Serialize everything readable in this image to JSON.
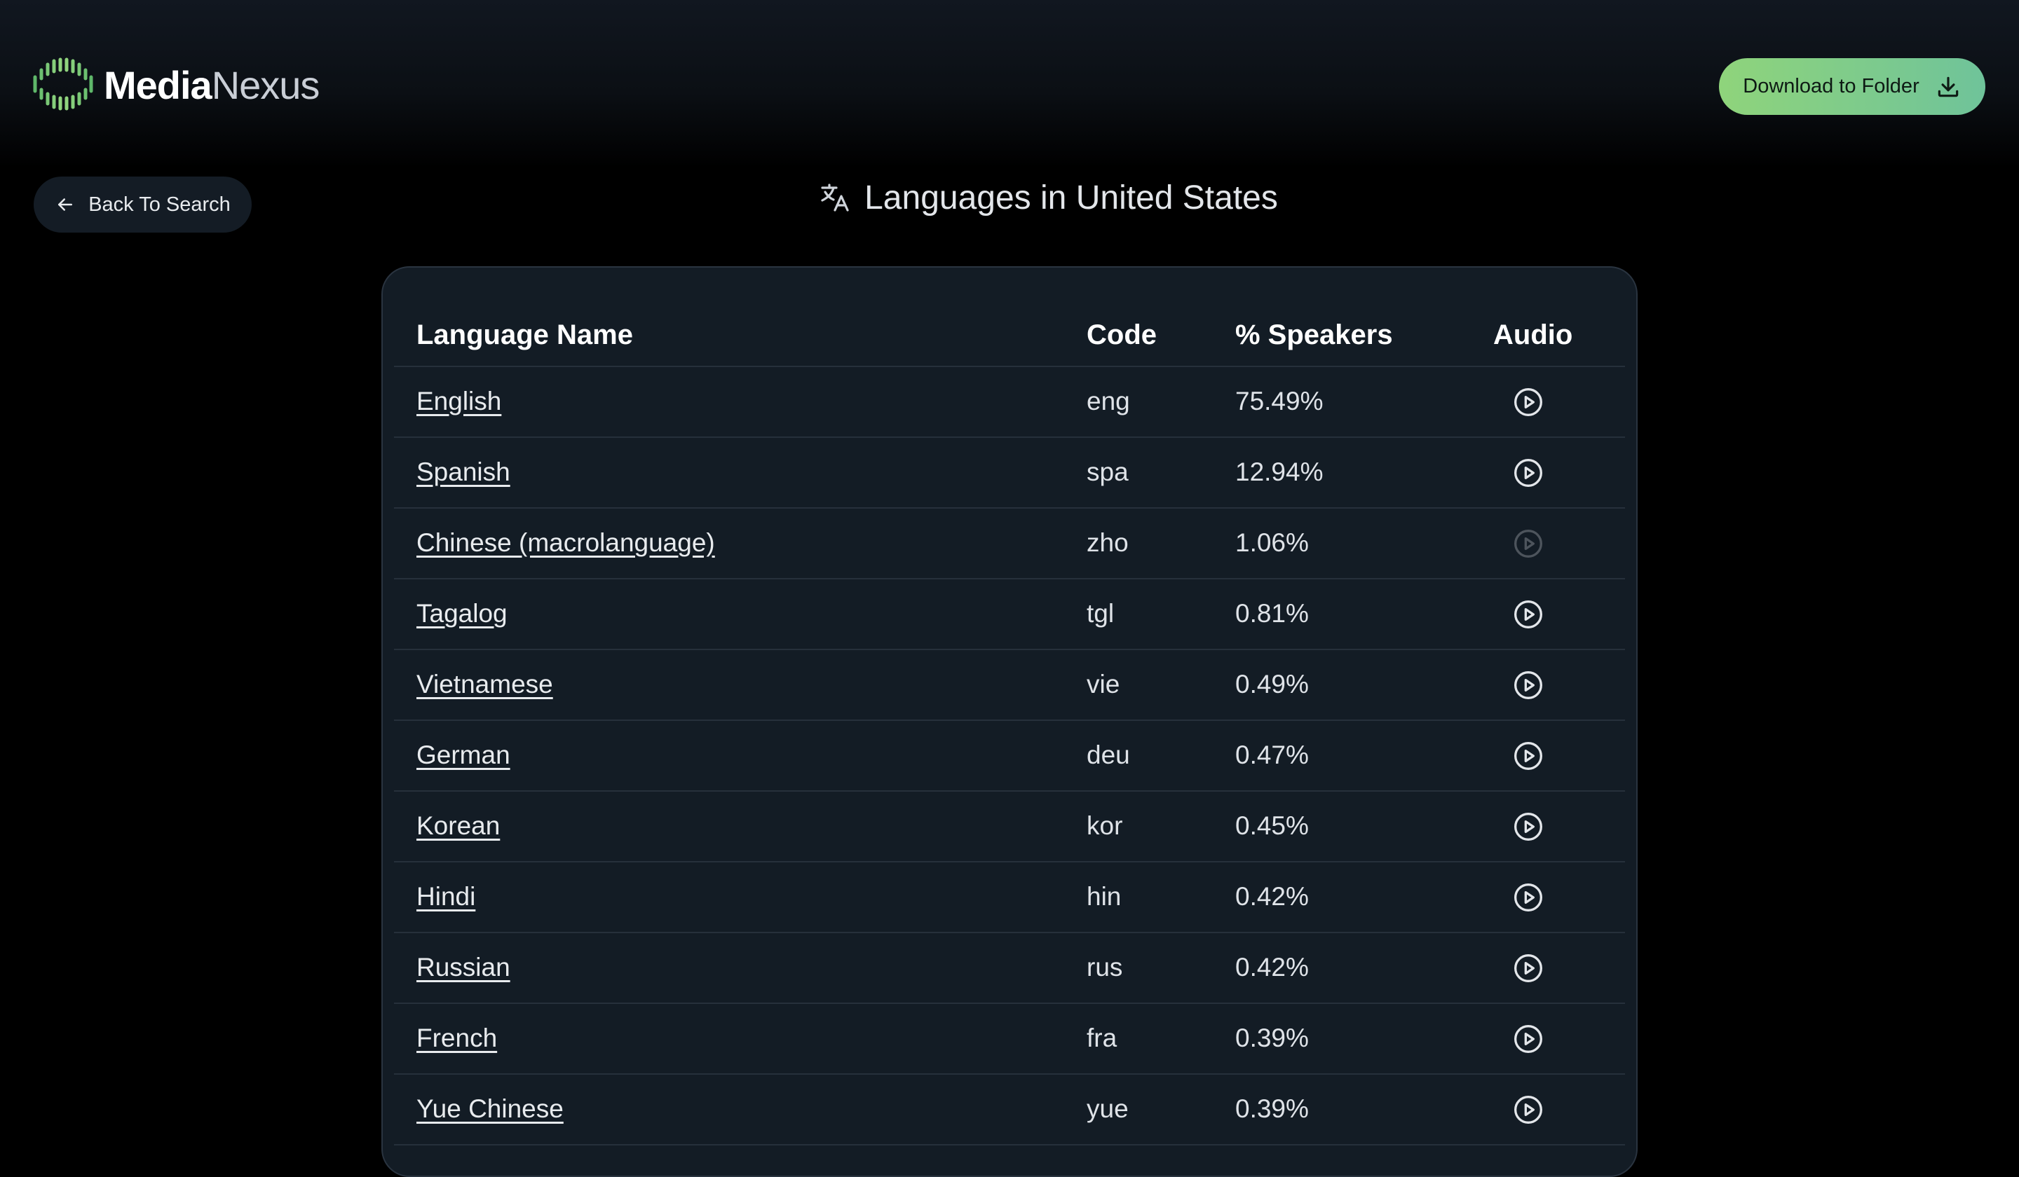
{
  "header": {
    "logo_primary": "Media",
    "logo_secondary": "Nexus",
    "download_label": "Download to Folder",
    "download_icon": "download-icon",
    "logo_icon": "soundwave-logo-icon"
  },
  "nav": {
    "back_label": "Back To Search",
    "back_icon": "arrow-left-icon"
  },
  "page": {
    "title": "Languages in United States",
    "title_icon": "translate-icon"
  },
  "table": {
    "headers": [
      "Language Name",
      "Code",
      "% Speakers",
      "Audio"
    ],
    "rows": [
      {
        "name": "English",
        "code": "eng",
        "pct": "75.49%",
        "audio": true
      },
      {
        "name": "Spanish",
        "code": "spa",
        "pct": "12.94%",
        "audio": true
      },
      {
        "name": "Chinese (macrolanguage)",
        "code": "zho",
        "pct": "1.06%",
        "audio": false
      },
      {
        "name": "Tagalog",
        "code": "tgl",
        "pct": "0.81%",
        "audio": true
      },
      {
        "name": "Vietnamese",
        "code": "vie",
        "pct": "0.49%",
        "audio": true
      },
      {
        "name": "German",
        "code": "deu",
        "pct": "0.47%",
        "audio": true
      },
      {
        "name": "Korean",
        "code": "kor",
        "pct": "0.45%",
        "audio": true
      },
      {
        "name": "Hindi",
        "code": "hin",
        "pct": "0.42%",
        "audio": true
      },
      {
        "name": "Russian",
        "code": "rus",
        "pct": "0.42%",
        "audio": true
      },
      {
        "name": "French",
        "code": "fra",
        "pct": "0.39%",
        "audio": true
      },
      {
        "name": "Yue Chinese",
        "code": "yue",
        "pct": "0.39%",
        "audio": true
      }
    ]
  },
  "colors": {
    "background": "#000000",
    "card": "#131c25",
    "accent_green": "#8fd47b",
    "accent_teal": "#6fc39a",
    "text": "#e6e8eb"
  }
}
